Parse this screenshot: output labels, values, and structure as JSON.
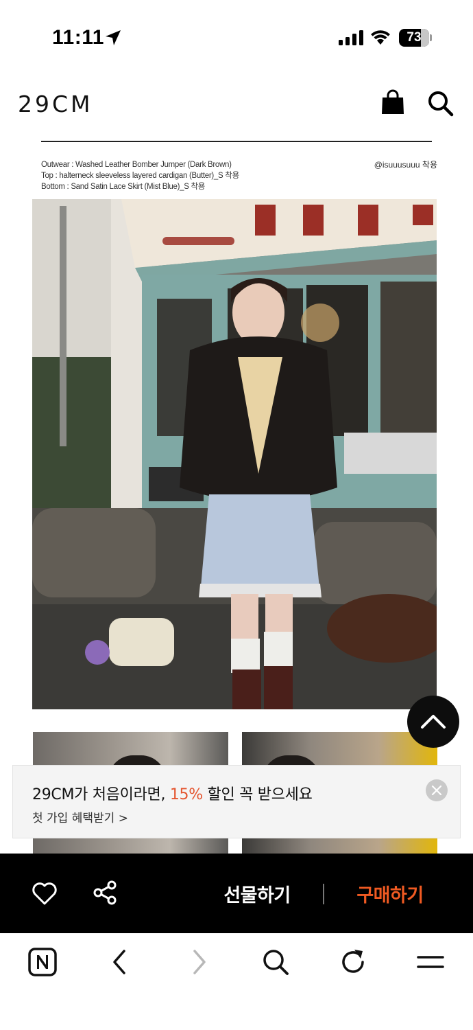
{
  "status_bar": {
    "time": "11:11",
    "battery_percent": "73",
    "battery_level": 0.73,
    "icons": [
      "location-arrow-icon",
      "cellular-signal-icon",
      "wifi-icon",
      "battery-icon"
    ]
  },
  "header": {
    "logo": "29CM",
    "icons": [
      "shopping-bag-icon",
      "search-icon"
    ]
  },
  "caption": {
    "lines": [
      "Outwear : Washed Leather Bomber Jumper (Dark Brown)",
      "Top : halterneck sleeveless layered cardigan (Butter)_S 착용",
      "Bottom : Sand Satin Lace Skirt (Mist Blue)_S 착용"
    ],
    "credit": "@isuuusuuu 착용"
  },
  "promo_banner": {
    "title_prefix": "29CM가 처음이라면, ",
    "title_accent": "15%",
    "title_suffix": " 할인 꼭 받으세요",
    "subtitle": "첫 가입 혜택받기 >",
    "accent_color": "#e4552f"
  },
  "action_bar": {
    "gift_label": "선물하기",
    "buy_label": "구매하기",
    "buy_color": "#f05a22",
    "icons": [
      "heart-icon",
      "share-icon"
    ]
  },
  "browser_toolbar": {
    "icons": [
      "naver-home-icon",
      "back-icon",
      "forward-icon",
      "search-icon",
      "refresh-icon",
      "menu-icon"
    ]
  }
}
